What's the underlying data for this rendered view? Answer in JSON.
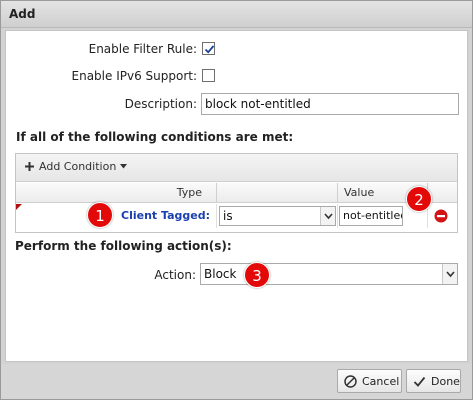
{
  "dialog": {
    "title": "Add"
  },
  "form": {
    "enable_filter_label": "Enable Filter Rule:",
    "enable_filter_checked": true,
    "enable_ipv6_label": "Enable IPv6 Support:",
    "enable_ipv6_checked": false,
    "description_label": "Description:",
    "description_value": "block not-entitled"
  },
  "conditions": {
    "heading": "If all of the following conditions are met:",
    "add_label": "Add Condition",
    "columns": {
      "type": "Type",
      "value": "Value"
    },
    "row": {
      "type_link": "Client Tagged:",
      "operator": "is",
      "value": "not-entitled"
    }
  },
  "actions": {
    "heading": "Perform the following action(s):",
    "action_label": "Action:",
    "action_value": "Block"
  },
  "badges": [
    "1",
    "2",
    "3"
  ],
  "footer": {
    "cancel_label": "Cancel",
    "done_label": "Done"
  },
  "colors": {
    "link": "#1a3fae",
    "badge": "#e30909",
    "delete_icon": "#d11515"
  }
}
